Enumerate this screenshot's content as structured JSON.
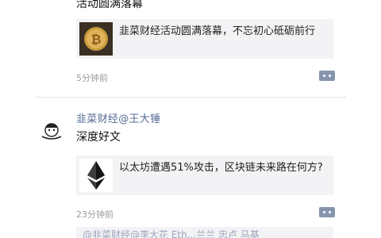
{
  "moments": [
    {
      "partial_text": "活动圆满落幕",
      "share": {
        "title": "韭菜财经活动圆满落幕，不忘初心砥砺前行",
        "thumb_icon": "bitcoin-coin-icon"
      },
      "time": "5分钟前"
    },
    {
      "author": "韭菜财经@王大锤",
      "text": "深度好文",
      "share": {
        "title": "以太坊遭遇51%攻击，区块链未来路在何方?",
        "thumb_icon": "ethereum-logo-icon"
      },
      "time": "23分钟前",
      "comment_preview": "@韭菜财经@李大花 Eth...兰兰 忠卢 马基"
    }
  ],
  "colors": {
    "link": "#576b95",
    "card_bg": "#f3f3f5",
    "time": "#9a9a9a",
    "comment_button": "#8794ae"
  }
}
